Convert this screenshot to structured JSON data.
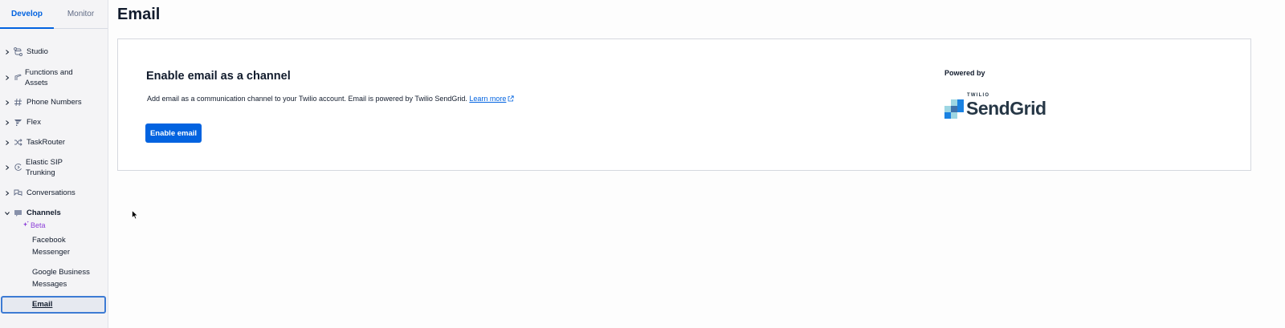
{
  "sidebar": {
    "tabs": [
      {
        "label": "Develop",
        "active": true
      },
      {
        "label": "Monitor",
        "active": false
      }
    ],
    "items": [
      {
        "label": "Studio",
        "icon": "studio-icon"
      },
      {
        "label": "Functions and Assets",
        "line1": "Functions and",
        "line2": "Assets",
        "icon": "functions-icon"
      },
      {
        "label": "Phone Numbers",
        "icon": "hash-icon"
      },
      {
        "label": "Flex",
        "icon": "flex-icon"
      },
      {
        "label": "TaskRouter",
        "icon": "taskrouter-icon"
      },
      {
        "label": "Elastic SIP Trunking",
        "line1": "Elastic SIP",
        "line2": "Trunking",
        "icon": "sip-icon"
      },
      {
        "label": "Conversations",
        "icon": "conversations-icon"
      },
      {
        "label": "Channels",
        "icon": "channels-icon",
        "expanded": true
      }
    ],
    "channels_badge": "Beta",
    "channels_sub": [
      {
        "line1": "Facebook",
        "line2": "Messenger"
      },
      {
        "line1": "Google Business",
        "line2": "Messages"
      },
      {
        "label": "Email",
        "active": true
      }
    ]
  },
  "main": {
    "title": "Email",
    "card": {
      "title": "Enable email as a channel",
      "description": "Add email as a communication channel to your Twilio account. Email is powered by Twilio SendGrid.",
      "learn_more": "Learn more",
      "button": "Enable email",
      "powered_by": "Powered by",
      "logo_small": "TWILIO",
      "logo_large": "SendGrid"
    }
  },
  "colors": {
    "accent": "#0263e0",
    "beta": "#8c3fd8",
    "sendgrid_blue": "#1a82e2",
    "text": "#121c2d"
  }
}
